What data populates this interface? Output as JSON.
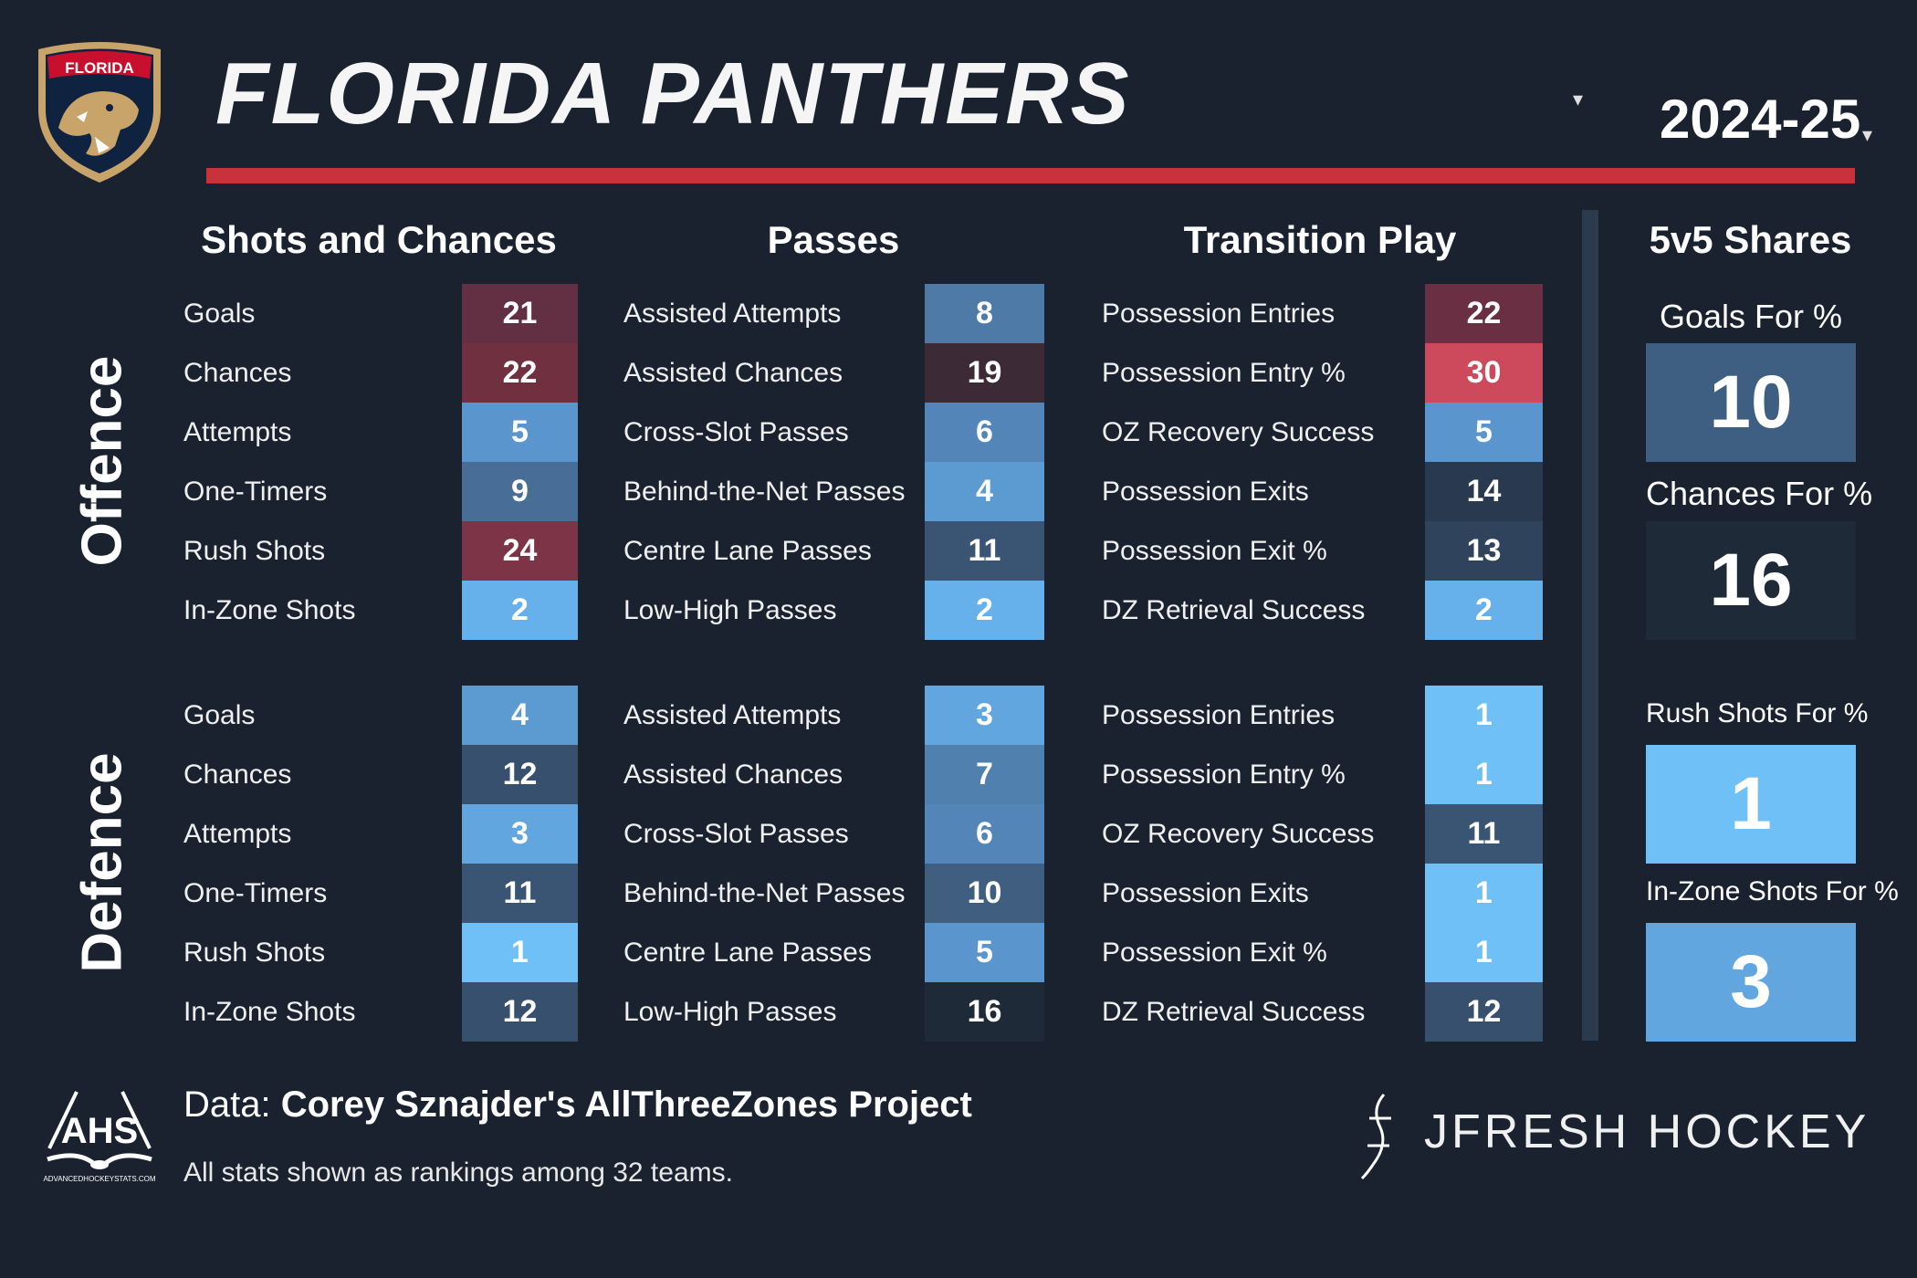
{
  "header": {
    "team": "FLORIDA PANTHERS",
    "season": "2024-25",
    "logo_text": "FLORIDA"
  },
  "colors": {
    "background": "#1a2230",
    "accent_red": "#c8323a",
    "rank_scale": [
      "#6ec0f7",
      "#5a9fd4",
      "#4a739f",
      "#38506f",
      "#233042",
      "#3e2a37",
      "#652f43",
      "#7a3145",
      "#c8465a"
    ]
  },
  "sections": {
    "shots": "Shots and Chances",
    "passes": "Passes",
    "transition": "Transition Play",
    "shares": "5v5 Shares",
    "offence": "Offence",
    "defence": "Defence"
  },
  "offence": {
    "shots": [
      {
        "label": "Goals",
        "value": "21",
        "color": "#632f42"
      },
      {
        "label": "Chances",
        "value": "22",
        "color": "#70303f"
      },
      {
        "label": "Attempts",
        "value": "5",
        "color": "#5a95cd"
      },
      {
        "label": "One-Timers",
        "value": "9",
        "color": "#486d97"
      },
      {
        "label": "Rush Shots",
        "value": "24",
        "color": "#7c3446"
      },
      {
        "label": "In-Zone Shots",
        "value": "2",
        "color": "#66b0ec"
      }
    ],
    "passes": [
      {
        "label": "Assisted Attempts",
        "value": "8",
        "color": "#4e7aa8"
      },
      {
        "label": "Assisted Chances",
        "value": "19",
        "color": "#3c2a36"
      },
      {
        "label": "Cross-Slot Passes",
        "value": "6",
        "color": "#5485b8"
      },
      {
        "label": "Behind-the-Net Passes",
        "value": "4",
        "color": "#5c9ad2"
      },
      {
        "label": "Centre Lane Passes",
        "value": "11",
        "color": "#3a5574"
      },
      {
        "label": "Low-High Passes",
        "value": "2",
        "color": "#66b0ec"
      }
    ],
    "transition": [
      {
        "label": "Possession Entries",
        "value": "22",
        "color": "#6a2f42"
      },
      {
        "label": "Possession Entry %",
        "value": "30",
        "color": "#cc4a5c"
      },
      {
        "label": "OZ Recovery Success",
        "value": "5",
        "color": "#5a95cd"
      },
      {
        "label": "Possession Exits",
        "value": "14",
        "color": "#293a50"
      },
      {
        "label": "Possession Exit %",
        "value": "13",
        "color": "#30435c"
      },
      {
        "label": "DZ Retrieval Success",
        "value": "2",
        "color": "#66b0ec"
      }
    ]
  },
  "defence": {
    "shots": [
      {
        "label": "Goals",
        "value": "4",
        "color": "#5c9ad2"
      },
      {
        "label": "Chances",
        "value": "12",
        "color": "#37506e"
      },
      {
        "label": "Attempts",
        "value": "3",
        "color": "#62a6e0"
      },
      {
        "label": "One-Timers",
        "value": "11",
        "color": "#3a5574"
      },
      {
        "label": "Rush Shots",
        "value": "1",
        "color": "#6ec0f7"
      },
      {
        "label": "In-Zone Shots",
        "value": "12",
        "color": "#37506e"
      }
    ],
    "passes": [
      {
        "label": "Assisted Attempts",
        "value": "3",
        "color": "#62a6e0"
      },
      {
        "label": "Assisted Chances",
        "value": "7",
        "color": "#5080ae"
      },
      {
        "label": "Cross-Slot Passes",
        "value": "6",
        "color": "#5485b8"
      },
      {
        "label": "Behind-the-Net Passes",
        "value": "10",
        "color": "#3f5e80"
      },
      {
        "label": "Centre Lane Passes",
        "value": "5",
        "color": "#5a95cd"
      },
      {
        "label": "Low-High Passes",
        "value": "16",
        "color": "#1f2a38"
      }
    ],
    "transition": [
      {
        "label": "Possession Entries",
        "value": "1",
        "color": "#6ec0f7"
      },
      {
        "label": "Possession Entry %",
        "value": "1",
        "color": "#6ec0f7"
      },
      {
        "label": "OZ Recovery Success",
        "value": "11",
        "color": "#3a5574"
      },
      {
        "label": "Possession Exits",
        "value": "1",
        "color": "#6ec0f7"
      },
      {
        "label": "Possession Exit %",
        "value": "1",
        "color": "#6ec0f7"
      },
      {
        "label": "DZ Retrieval Success",
        "value": "12",
        "color": "#37506e"
      }
    ]
  },
  "shares": [
    {
      "label": "Goals For %",
      "value": "10",
      "color": "#3e5e82"
    },
    {
      "label": "Chances For %",
      "value": "16",
      "color": "#1f2a38"
    },
    {
      "label": "Rush Shots For %",
      "value": "1",
      "color": "#6ec0f7"
    },
    {
      "label": "In-Zone Shots For %",
      "value": "3",
      "color": "#62a6e0"
    }
  ],
  "footer": {
    "data_prefix": "Data: ",
    "data_source": "Corey Sznajder's AllThreeZones Project",
    "note": "All stats shown as rankings among 32 teams.",
    "ahs_text": "AHS",
    "ahs_url": "ADVANCEDHOCKEYSTATS.COM",
    "brand": "JFRESH HOCKEY"
  }
}
